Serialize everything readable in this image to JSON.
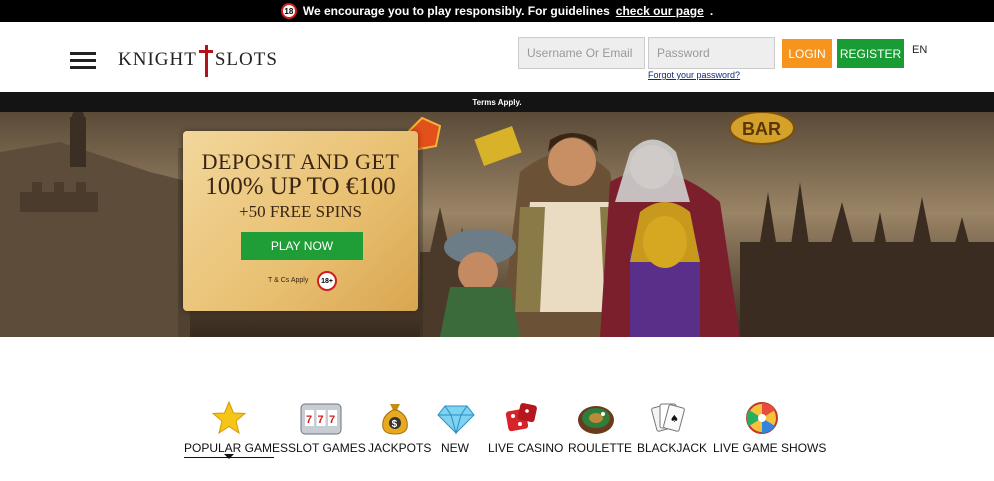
{
  "notice": {
    "age": "18",
    "text": "We encourage you to play responsibly. For guidelines",
    "link": "check our page",
    "end": "."
  },
  "header": {
    "logo_left": "KNIGHT",
    "logo_right": "SLOTS",
    "username_placeholder": "Username Or Email",
    "password_placeholder": "Password",
    "forgot": "Forgot your password?",
    "login": "LOGIN",
    "register": "REGISTER",
    "lang": "EN"
  },
  "banner": {
    "terms": "Terms Apply.",
    "line1": "DEPOSIT AND GET",
    "line2": "100% UP TO €100",
    "line3": "+50 FREE SPINS",
    "play": "PLAY NOW",
    "tc": "T & Cs Apply",
    "age": "18+",
    "sign": "BAR"
  },
  "categories": [
    {
      "label": "POPULAR GAMES",
      "icon": "star-icon"
    },
    {
      "label": "SLOT GAMES",
      "icon": "slot-machine-icon"
    },
    {
      "label": "JACKPOTS",
      "icon": "money-bag-icon"
    },
    {
      "label": "NEW",
      "icon": "diamond-icon"
    },
    {
      "label": "LIVE CASINO",
      "icon": "dice-icon"
    },
    {
      "label": "ROULETTE",
      "icon": "roulette-icon"
    },
    {
      "label": "BLACKJACK",
      "icon": "cards-icon"
    },
    {
      "label": "LIVE GAME SHOWS",
      "icon": "wheel-icon"
    }
  ],
  "colors": {
    "login": "#f7941d",
    "register": "#1a9c34",
    "play": "#1f9d37",
    "brand_red": "#b3121b"
  }
}
